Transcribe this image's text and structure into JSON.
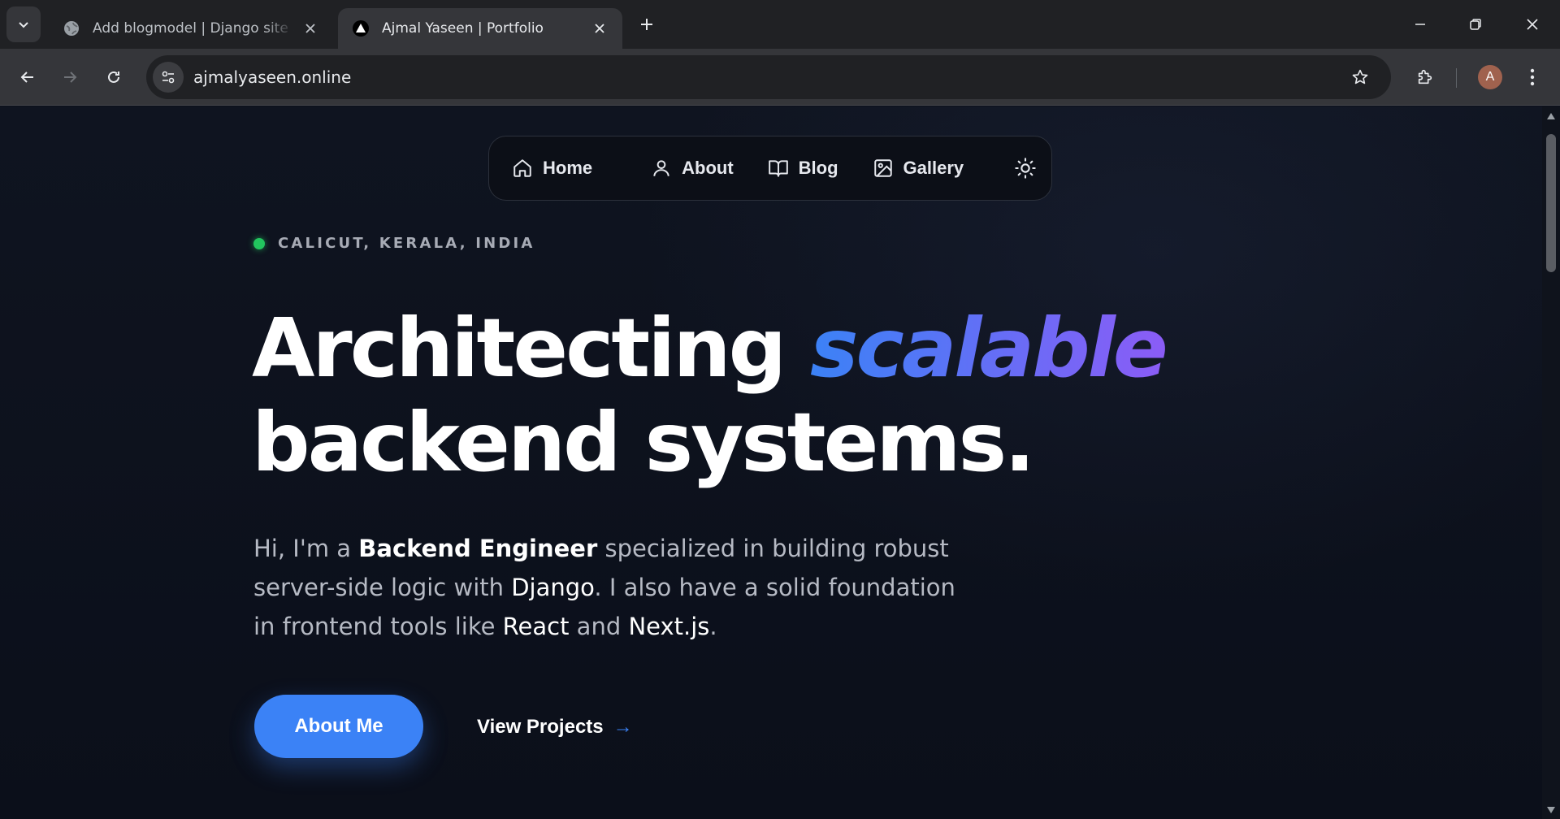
{
  "browser": {
    "tabs": [
      {
        "title": "Add blogmodel | Django site ac",
        "favicon": "globe-icon",
        "active": false
      },
      {
        "title": "Ajmal Yaseen | Portfolio",
        "favicon": "triangle-logo-icon",
        "active": true
      }
    ],
    "url": "ajmalyaseen.online",
    "profile_initial": "A"
  },
  "page": {
    "nav": {
      "items": [
        {
          "label": "Home",
          "icon": "home-icon"
        },
        {
          "label": "About",
          "icon": "user-icon"
        },
        {
          "label": "Blog",
          "icon": "book-icon"
        },
        {
          "label": "Gallery",
          "icon": "image-icon"
        }
      ],
      "theme_toggle_icon": "sun-icon"
    },
    "location": "CALICUT, KERALA, INDIA",
    "headline": {
      "word1": "Architecting ",
      "accent": "scalable",
      "line2": "backend systems."
    },
    "intro": {
      "p1": "Hi, I'm a ",
      "role": "Backend Engineer",
      "p2": " specialized in building robust server-side logic with ",
      "django": "Django",
      "p3": ". I also have a solid foundation in frontend tools like ",
      "react": "React",
      "p4": " and ",
      "next": "Next.js",
      "p5": "."
    },
    "cta": {
      "primary": "About Me",
      "secondary": "View Projects",
      "secondary_arrow": "→"
    },
    "colors": {
      "accent_blue": "#3b82f6",
      "accent_purple": "#8b5cf6",
      "status_green": "#22c55e",
      "background": "#0b0f1a"
    }
  }
}
